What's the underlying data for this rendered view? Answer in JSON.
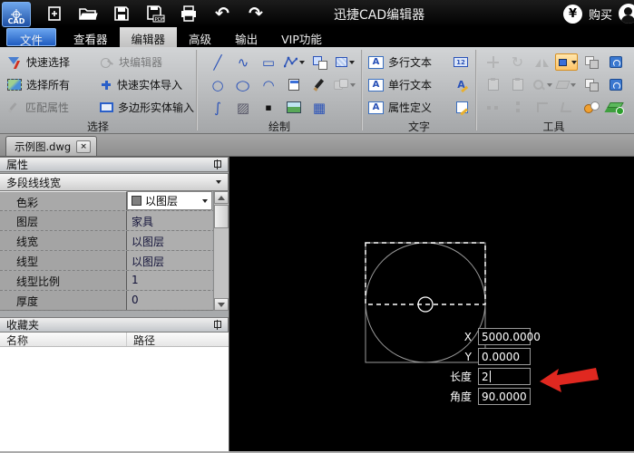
{
  "app": {
    "title": "迅捷CAD编辑器",
    "logo": "CAD",
    "buy_label": "购买"
  },
  "menubar": {
    "items": [
      {
        "label": "文件"
      },
      {
        "label": "查看器"
      },
      {
        "label": "编辑器"
      },
      {
        "label": "高级"
      },
      {
        "label": "输出"
      },
      {
        "label": "VIP功能"
      }
    ]
  },
  "ribbon": {
    "selection": {
      "label": "选择",
      "buttons": [
        {
          "label": "快速选择",
          "enabled": true
        },
        {
          "label": "块编辑器",
          "enabled": false
        },
        {
          "label": "选择所有",
          "enabled": true
        },
        {
          "label": "快速实体导入",
          "enabled": true
        },
        {
          "label": "匹配属性",
          "enabled": false
        },
        {
          "label": "多边形实体输入",
          "enabled": true
        }
      ]
    },
    "draw": {
      "label": "绘制"
    },
    "text": {
      "label": "文字",
      "buttons": [
        {
          "label": "多行文本"
        },
        {
          "label": "单行文本"
        },
        {
          "label": "属性定义"
        }
      ],
      "ruler_icon_text": "12"
    },
    "tools": {
      "label": "工具"
    }
  },
  "tabbar": {
    "tabs": [
      {
        "label": "示例图.dwg",
        "active": true
      }
    ]
  },
  "properties": {
    "title": "属性",
    "selector": "多段线线宽",
    "rows": [
      {
        "name": "色彩",
        "value": "以图层"
      },
      {
        "name": "图层",
        "value": "家具"
      },
      {
        "name": "线宽",
        "value": "以图层"
      },
      {
        "name": "线型",
        "value": "以图层"
      },
      {
        "name": "线型比例",
        "value": "1"
      },
      {
        "name": "厚度",
        "value": "0"
      }
    ]
  },
  "favorites": {
    "title": "收藏夹",
    "columns": {
      "name": "名称",
      "path": "路径"
    }
  },
  "canvas": {
    "coords": [
      {
        "label": "X",
        "value": "5000.0000"
      },
      {
        "label": "Y",
        "value": "0.0000"
      },
      {
        "label": "长度",
        "value": "2",
        "focused": true
      },
      {
        "label": "角度",
        "value": "90.0000"
      }
    ]
  },
  "icons": {
    "yen": "¥",
    "close": "×",
    "undo": "↶",
    "redo": "↷",
    "line": "╱",
    "spline": "∿",
    "rectangle": "▭",
    "circle": "○",
    "arc": "◠",
    "scurve": "∫",
    "hatch": "▨",
    "point": "▪",
    "table": "▦",
    "letter_a": "A",
    "rotate": "↻"
  },
  "colors": {
    "accent_blue": "#2b6cd4",
    "highlight_orange": "#fdc468",
    "canvas_bg": "#000000",
    "arrow_red": "#e02820",
    "bylayer_swatch": "#808080"
  }
}
